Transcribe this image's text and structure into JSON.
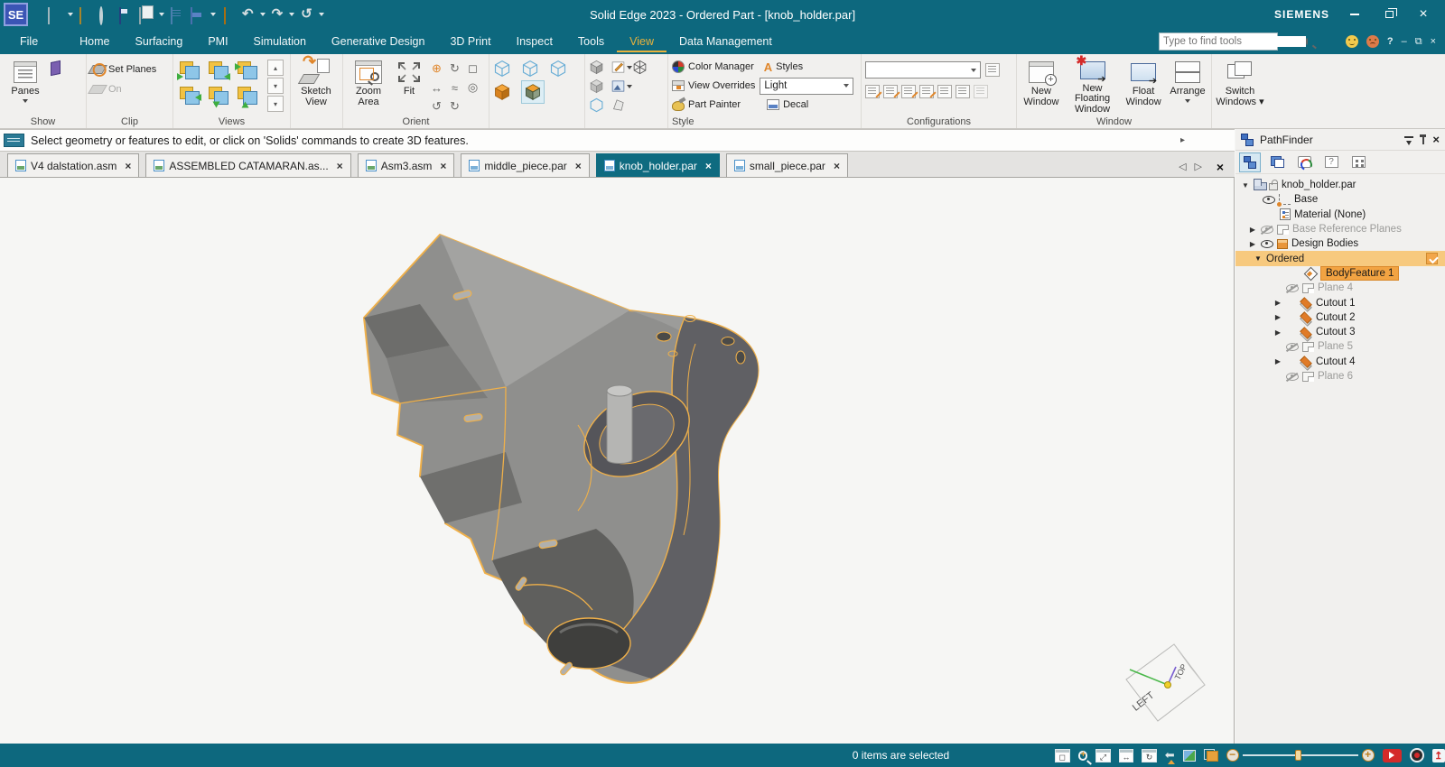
{
  "colors": {
    "titlebar_teal": "#0d687e",
    "active_tab_gold": "#e9b23c",
    "ribbon_bg": "#f1f0ee",
    "edge_orange": "#efb04a",
    "selection_row_orange": "#f7c97e",
    "selection_chip_orange": "#f2a342"
  },
  "titlebar": {
    "logo": "SE",
    "title": "Solid Edge 2023 - Ordered Part - [knob_holder.par]",
    "brand": "SIEMENS",
    "qat_icons": [
      "new-document",
      "open",
      "hyperlink",
      "save",
      "copy",
      "list-view",
      "image-view",
      "exit",
      "undo",
      "redo",
      "repeat"
    ]
  },
  "menu": {
    "tabs": [
      {
        "label": "File"
      },
      {
        "label": "Home"
      },
      {
        "label": "Surfacing"
      },
      {
        "label": "PMI"
      },
      {
        "label": "Simulation"
      },
      {
        "label": "Generative Design"
      },
      {
        "label": "3D Print"
      },
      {
        "label": "Inspect"
      },
      {
        "label": "Tools"
      },
      {
        "label": "View",
        "active": true
      },
      {
        "label": "Data Management"
      }
    ],
    "search_placeholder": "Type to find tools"
  },
  "ribbon": {
    "groups": {
      "show": "Show",
      "clip": "Clip",
      "views": "Views",
      "orient": "Orient",
      "style": "Style",
      "configurations": "Configurations",
      "window": "Window"
    },
    "buttons": {
      "panes": "Panes",
      "set_planes": "Set Planes",
      "clip_on": "On",
      "sketch_view": "Sketch View",
      "zoom_area": "Zoom Area",
      "fit": "Fit",
      "color_manager": "Color Manager",
      "styles": "Styles",
      "view_overrides": "View Overrides",
      "part_painter": "Part Painter",
      "decal": "Decal",
      "new_window": "New Window",
      "new_floating_window": "New Floating Window",
      "float_window": "Float Window",
      "arrange": "Arrange",
      "switch_windows": "Switch Windows"
    },
    "style_dropdown_value": "Light"
  },
  "prompt_bar": {
    "message": "Select geometry or features to edit, or click on 'Solids' commands to create 3D features."
  },
  "document_tabs": [
    {
      "label": "V4 dalstation.asm"
    },
    {
      "label": "ASSEMBLED CATAMARAN.as..."
    },
    {
      "label": "Asm3.asm"
    },
    {
      "label": "middle_piece.par"
    },
    {
      "label": "knob_holder.par",
      "active": true
    },
    {
      "label": "small_piece.par"
    }
  ],
  "pathfinder": {
    "title": "PathFinder",
    "toolbar_icons": [
      "pathfinder",
      "layers",
      "sensors",
      "info",
      "feature-library"
    ],
    "tree": [
      {
        "label": "knob_holder.par",
        "icon": "part"
      },
      {
        "label": "Base",
        "icon": "base-coordinate-system"
      },
      {
        "label": "Material (None)",
        "icon": "material"
      },
      {
        "label": "Base Reference Planes",
        "icon": "plane",
        "muted": true
      },
      {
        "label": "Design Bodies",
        "icon": "design-body"
      },
      {
        "label": "Ordered",
        "selected": "row"
      },
      {
        "label": "BodyFeature 1",
        "icon": "body-feature",
        "selected": "chip"
      },
      {
        "label": "Plane 4",
        "icon": "plane",
        "muted": true
      },
      {
        "label": "Cutout 1",
        "icon": "cutout"
      },
      {
        "label": "Cutout 2",
        "icon": "cutout"
      },
      {
        "label": "Cutout 3",
        "icon": "cutout"
      },
      {
        "label": "Plane 5",
        "icon": "plane",
        "muted": true
      },
      {
        "label": "Cutout 4",
        "icon": "cutout"
      },
      {
        "label": "Plane 6",
        "icon": "plane",
        "muted": true
      }
    ]
  },
  "viewport": {
    "triad": {
      "labels": [
        "LEFT",
        "TOP"
      ]
    }
  },
  "statusbar": {
    "message": "0 items are selected",
    "icons": [
      "zoom-area",
      "zoom",
      "fit",
      "zoom-width",
      "rotate",
      "previous-view",
      "sketch-view",
      "named-views",
      "zoom-out",
      "zoom-slider",
      "zoom-in",
      "video",
      "record",
      "share"
    ]
  }
}
